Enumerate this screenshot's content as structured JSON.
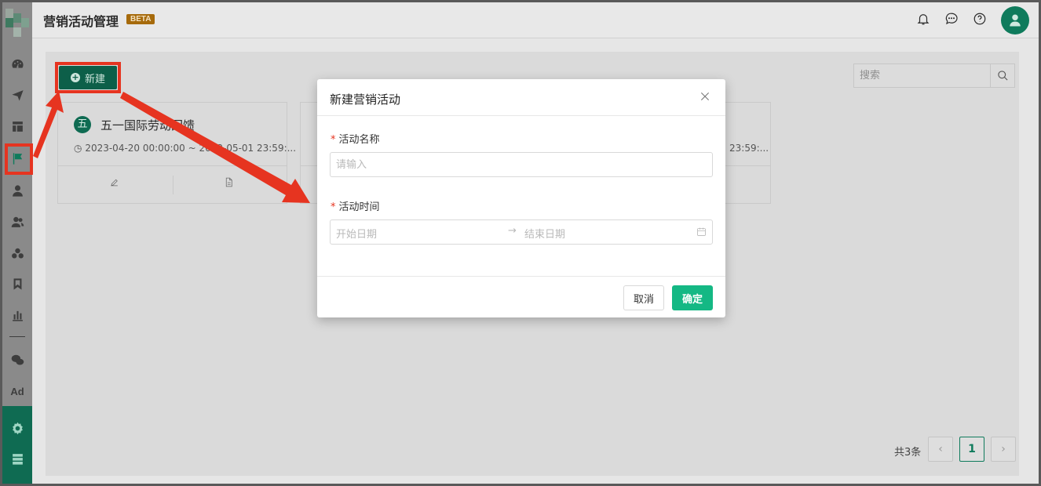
{
  "header": {
    "title": "营销活动管理",
    "badge": "BETA",
    "icons": [
      "bell-icon",
      "message-icon",
      "help-icon",
      "user-avatar-icon"
    ]
  },
  "sidebar": {
    "items": [
      "dashboard-icon",
      "send-icon",
      "layout-icon",
      "flag-icon",
      "user-icon",
      "users-icon",
      "group-icon",
      "bookmark-icon",
      "bar-chart-icon",
      "wechat-icon",
      "ad-icon",
      "settings-icon",
      "server-icon"
    ],
    "ad_label": "Ad",
    "active": "flag-icon"
  },
  "toolbar": {
    "new_label": "新建",
    "search_placeholder": "搜索"
  },
  "cards": [
    {
      "badge": "五",
      "name": "五一国际劳动回馈",
      "time": "2023-04-20 00:00:00 ~ 2023-05-01 23:59:..."
    },
    {
      "time_tail": "23:59:..."
    }
  ],
  "pagination": {
    "total": "共3条",
    "current": "1"
  },
  "modal": {
    "title": "新建营销活动",
    "name_label": "活动名称",
    "name_placeholder": "请输入",
    "time_label": "活动时间",
    "start_placeholder": "开始日期",
    "range_arrow": "→",
    "end_placeholder": "结束日期",
    "required_mark": "*",
    "cancel_label": "取消",
    "ok_label": "确定"
  },
  "colors": {
    "accent": "#14b884",
    "brand_dark": "#0f6b52",
    "annotation_red": "#e63420",
    "beta": "#a66a0b"
  }
}
